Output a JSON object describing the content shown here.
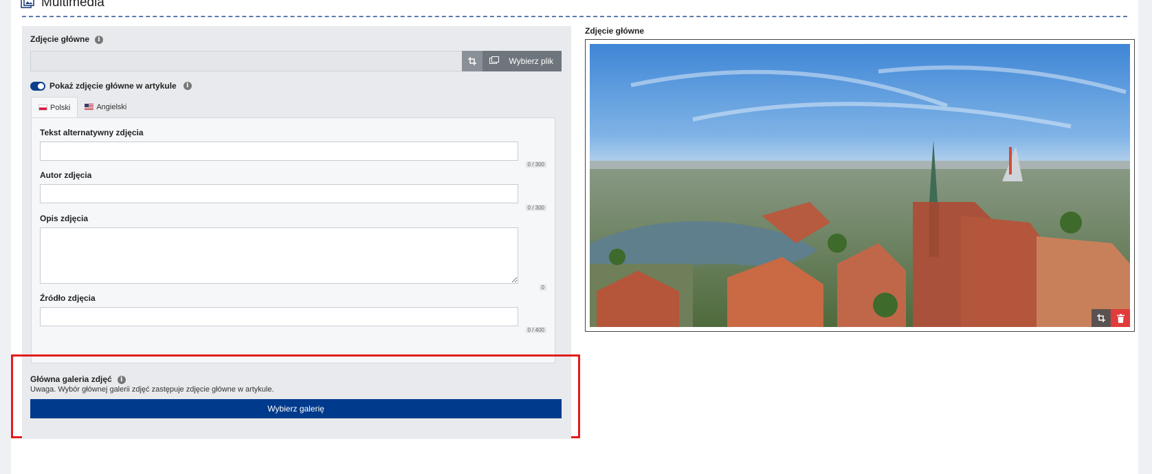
{
  "section": {
    "title": "Multimedia",
    "icon": "images-icon"
  },
  "main_photo": {
    "label": "Zdjęcie główne",
    "choose_file_label": "Wybierz plik",
    "show_in_article_label": "Pokaż zdjęcie główne w artykule",
    "show_in_article_checked": true
  },
  "tabs": [
    {
      "label": "Polski",
      "active": true
    },
    {
      "label": "Angielski",
      "active": false
    }
  ],
  "fields": {
    "alt_text": {
      "label": "Tekst alternatywny zdjęcia",
      "value": "",
      "counter": "0 / 300"
    },
    "author": {
      "label": "Autor zdjęcia",
      "value": "",
      "counter": "0 / 300"
    },
    "description": {
      "label": "Opis zdjęcia",
      "value": "",
      "counter": "0"
    },
    "source": {
      "label": "Źródło zdjęcia",
      "value": "",
      "counter": "0 / 400"
    }
  },
  "gallery": {
    "label": "Główna galeria zdjęć",
    "note": "Uwaga. Wybór głównej galerii zdjęć zastępuje zdjęcie główne w artykule.",
    "button_label": "Wybierz galerię"
  },
  "preview": {
    "label": "Zdjęcie główne"
  },
  "colors": {
    "primary": "#003a8c",
    "danger": "#e23b3b",
    "highlight": "#e21b1b"
  }
}
